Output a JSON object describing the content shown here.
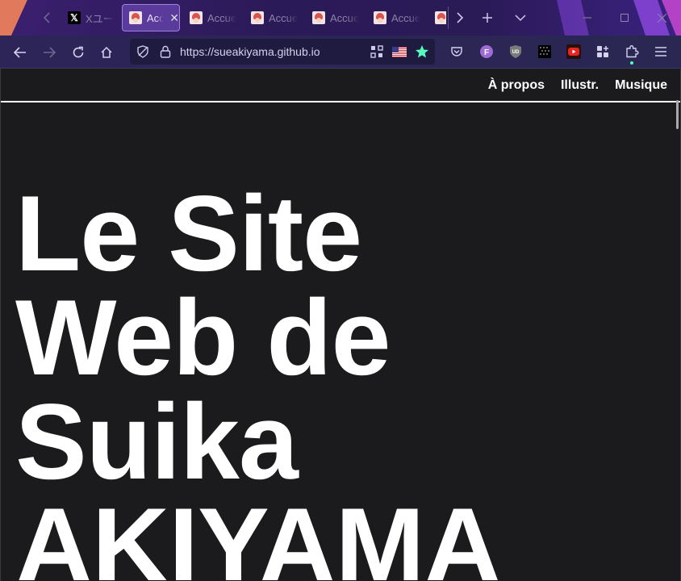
{
  "tabs": [
    {
      "label": "Xユーザー",
      "favicon": "x-favicon",
      "active": false
    },
    {
      "label": "Accueil",
      "favicon": "suika-favicon",
      "active": true
    },
    {
      "label": "Accueil",
      "favicon": "suika-favicon",
      "active": false
    },
    {
      "label": "Accueil",
      "favicon": "suika-favicon",
      "active": false
    },
    {
      "label": "Accueil",
      "favicon": "suika-favicon",
      "active": false
    },
    {
      "label": "Accueil",
      "favicon": "suika-favicon",
      "active": false
    },
    {
      "label": "",
      "favicon": "suika-favicon",
      "active": false
    }
  ],
  "address_bar": {
    "url": "https://sueakiyama.github.io"
  },
  "site": {
    "nav": [
      "À propos",
      "Illustr.",
      "Musique"
    ],
    "hero_lines": [
      "Le Site",
      "Web de",
      "Suika",
      "AKIYAMA"
    ]
  },
  "colors": {
    "page_background": "#1b1a1c",
    "tab_accent": "#9d82e0",
    "bookmark_star": "#54ffbd"
  },
  "icons": {
    "tab_scroll_left": "chevron-left-icon",
    "tab_scroll_right": "chevron-right-icon",
    "new_tab": "plus-icon",
    "list_tabs": "chevron-down-icon",
    "minimize": "minimize-icon",
    "maximize": "maximize-icon",
    "close": "close-icon",
    "back": "arrow-left-icon",
    "forward": "arrow-right-icon",
    "reload": "reload-icon",
    "home": "home-icon",
    "tracking": "shield-icon",
    "lock": "lock-icon",
    "qr": "qr-code-icon",
    "translate": "us-flag-icon",
    "bookmark": "star-icon",
    "pocket": "pocket-icon",
    "extension_f": "f-extension-icon",
    "ublock": "ublock-icon",
    "extension_grid": "dotted-grid-icon",
    "youtube_ext": "youtube-icon",
    "apps": "apps-icon",
    "extensions": "puzzle-icon",
    "menu": "hamburger-menu-icon"
  }
}
